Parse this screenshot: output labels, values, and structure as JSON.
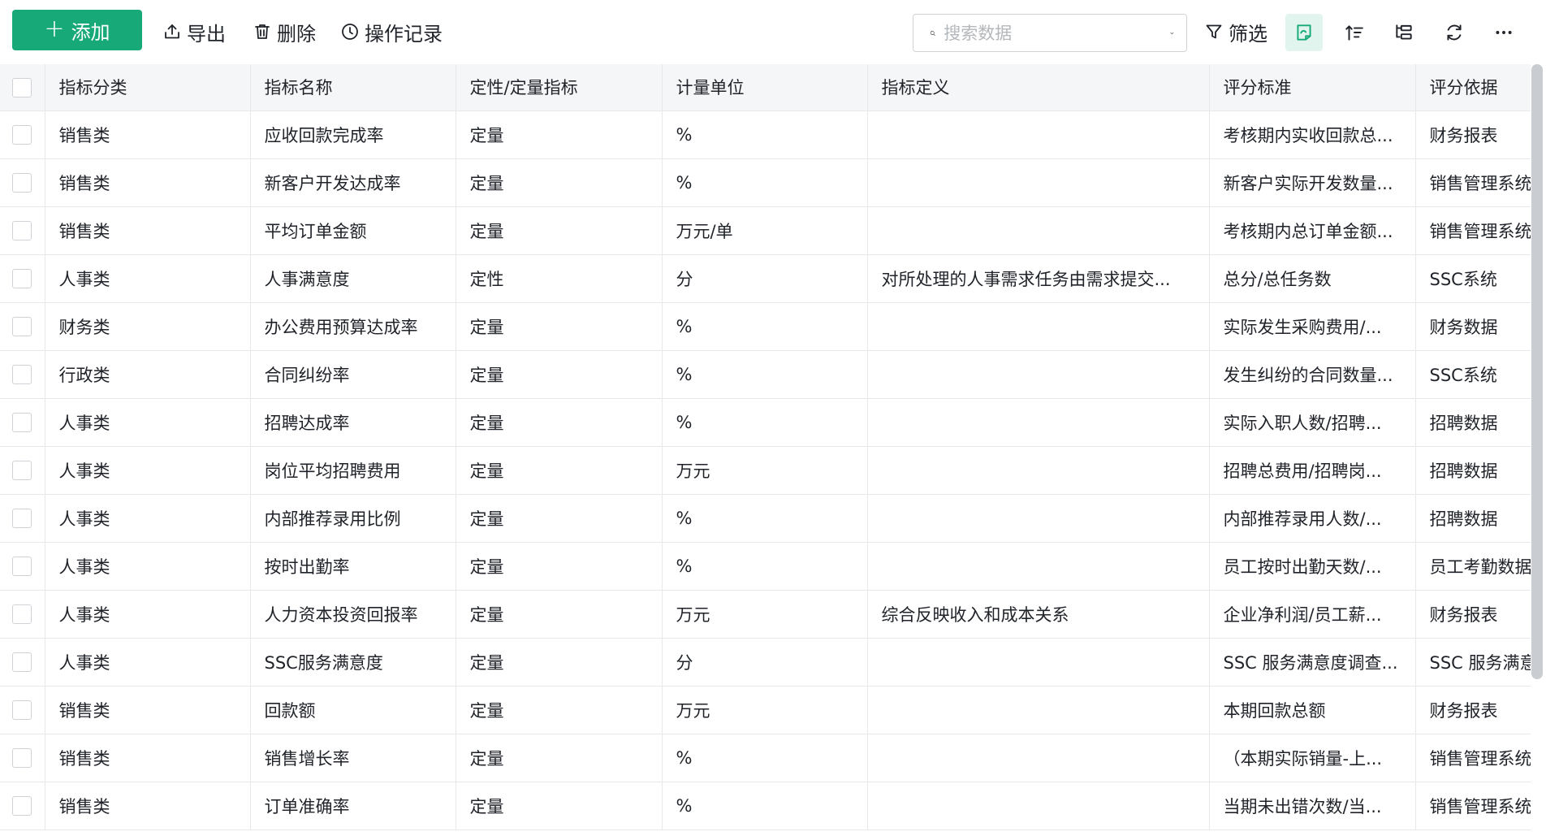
{
  "toolbar": {
    "add_label": "添加",
    "export_label": "导出",
    "delete_label": "删除",
    "history_label": "操作记录",
    "search_placeholder": "搜索数据",
    "filter_label": "筛选"
  },
  "table": {
    "columns": [
      "指标分类",
      "指标名称",
      "定性/定量指标",
      "计量单位",
      "指标定义",
      "评分标准",
      "评分依据"
    ],
    "rows": [
      [
        "销售类",
        "应收回款完成率",
        "定量",
        "%",
        "",
        "考核期内实收回款总...",
        "财务报表"
      ],
      [
        "销售类",
        "新客户开发达成率",
        "定量",
        "%",
        "",
        "新客户实际开发数量...",
        "销售管理系统"
      ],
      [
        "销售类",
        "平均订单金额",
        "定量",
        "万元/单",
        "",
        "考核期内总订单金额...",
        "销售管理系统"
      ],
      [
        "人事类",
        "人事满意度",
        "定性",
        "分",
        "对所处理的人事需求任务由需求提交...",
        "总分/总任务数",
        "SSC系统"
      ],
      [
        "财务类",
        "办公费用预算达成率",
        "定量",
        "%",
        "",
        "实际发生采购费用/...",
        "财务数据"
      ],
      [
        "行政类",
        "合同纠纷率",
        "定量",
        "%",
        "",
        "发生纠纷的合同数量...",
        "SSC系统"
      ],
      [
        "人事类",
        "招聘达成率",
        "定量",
        "%",
        "",
        "实际入职人数/招聘...",
        "招聘数据"
      ],
      [
        "人事类",
        "岗位平均招聘费用",
        "定量",
        "万元",
        "",
        "招聘总费用/招聘岗...",
        "招聘数据"
      ],
      [
        "人事类",
        "内部推荐录用比例",
        "定量",
        "%",
        "",
        "内部推荐录用人数/...",
        "招聘数据"
      ],
      [
        "人事类",
        "按时出勤率",
        "定量",
        "%",
        "",
        "员工按时出勤天数/...",
        "员工考勤数据"
      ],
      [
        "人事类",
        "人力资本投资回报率",
        "定量",
        "万元",
        "综合反映收入和成本关系",
        "企业净利润/员工薪...",
        "财务报表"
      ],
      [
        "人事类",
        "SSC服务满意度",
        "定量",
        "分",
        "",
        "SSC 服务满意度调查...",
        "SSC 服务满意度"
      ],
      [
        "销售类",
        "回款额",
        "定量",
        "万元",
        "",
        "本期回款总额",
        "财务报表"
      ],
      [
        "销售类",
        "销售增长率",
        "定量",
        "%",
        "",
        "（本期实际销量-上...",
        "销售管理系统"
      ],
      [
        "销售类",
        "订单准确率",
        "定量",
        "%",
        "",
        "当期未出错次数/当...",
        "销售管理系统"
      ]
    ]
  },
  "colors": {
    "accent": "#18a978",
    "header_bg": "#f5f6f7",
    "grid": "#e6e8ea"
  },
  "icons": [
    "plus-icon",
    "export-icon",
    "trash-icon",
    "clock-icon",
    "search-icon",
    "chevron-down-icon",
    "filter-icon",
    "card-view-icon",
    "sort-icon",
    "group-icon",
    "refresh-icon",
    "more-icon"
  ]
}
